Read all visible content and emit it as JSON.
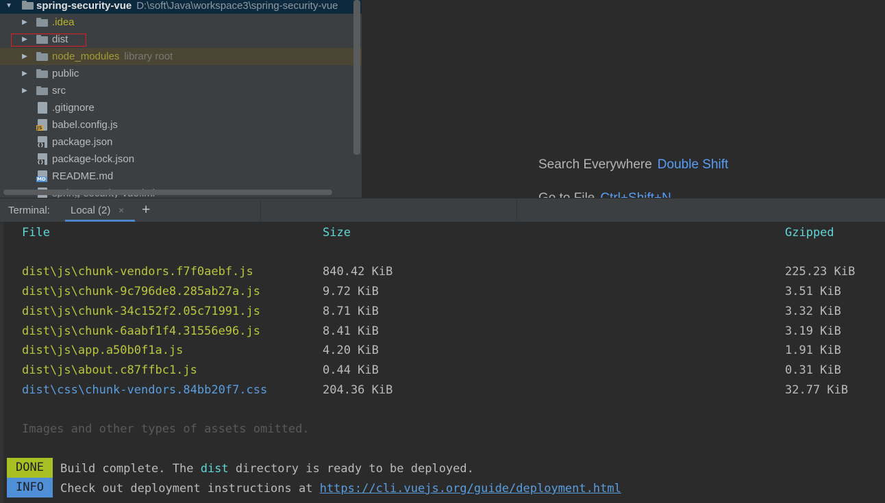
{
  "project": {
    "root_name": "spring-security-vue",
    "root_path": "D:\\soft\\Java\\workspace3\\spring-security-vue",
    "items": [
      {
        "label": ".idea",
        "type": "folder",
        "extra": ""
      },
      {
        "label": "dist",
        "type": "folder",
        "extra": ""
      },
      {
        "label": "node_modules",
        "type": "folder",
        "extra": "library root"
      },
      {
        "label": "public",
        "type": "folder",
        "extra": ""
      },
      {
        "label": "src",
        "type": "folder",
        "extra": ""
      },
      {
        "label": ".gitignore",
        "type": "file",
        "extra": ""
      },
      {
        "label": "babel.config.js",
        "type": "file",
        "extra": "",
        "tag": "JS"
      },
      {
        "label": "package.json",
        "type": "file",
        "extra": "",
        "tag": "{}"
      },
      {
        "label": "package-lock.json",
        "type": "file",
        "extra": "",
        "tag": "{}"
      },
      {
        "label": "README.md",
        "type": "file",
        "extra": "",
        "tag": "MD"
      },
      {
        "label": "spring-security-vue.iml",
        "type": "file",
        "extra": ""
      }
    ]
  },
  "editor": {
    "hints": [
      {
        "action": "Search Everywhere",
        "shortcut": "Double Shift"
      },
      {
        "action": "Go to File",
        "shortcut": "Ctrl+Shift+N"
      }
    ]
  },
  "terminal": {
    "title": "Terminal:",
    "tab_label": "Local (2)",
    "close_glyph": "×",
    "add_glyph": "+",
    "headers": {
      "file": "File",
      "size": "Size",
      "gzipped": "Gzipped"
    },
    "rows": [
      {
        "file": "dist\\js\\chunk-vendors.f7f0aebf.js",
        "size": "840.42 KiB",
        "gzipped": "225.23 KiB"
      },
      {
        "file": "dist\\js\\chunk-9c796de8.285ab27a.js",
        "size": "9.72 KiB",
        "gzipped": "3.51 KiB"
      },
      {
        "file": "dist\\js\\chunk-34c152f2.05c71991.js",
        "size": "8.71 KiB",
        "gzipped": "3.32 KiB"
      },
      {
        "file": "dist\\js\\chunk-6aabf1f4.31556e96.js",
        "size": "8.41 KiB",
        "gzipped": "3.19 KiB"
      },
      {
        "file": "dist\\js\\app.a50b0f1a.js",
        "size": "4.20 KiB",
        "gzipped": "1.91 KiB"
      },
      {
        "file": "dist\\js\\about.c87ffbc1.js",
        "size": "0.44 KiB",
        "gzipped": "0.31 KiB"
      },
      {
        "file": "dist\\css\\chunk-vendors.84bb20f7.css",
        "size": "204.36 KiB",
        "gzipped": "32.77 KiB"
      }
    ],
    "omitted_note": "Images and other types of assets omitted.",
    "done_badge": "DONE",
    "done_msg_pre": "Build complete. The ",
    "done_msg_dir": "dist",
    "done_msg_post": " directory is ready to be deployed.",
    "info_badge": "INFO",
    "info_msg": "Check out deployment instructions at ",
    "info_link": "https://cli.vuejs.org/guide/deployment.html"
  },
  "colors": {
    "accent_blue": "#4a88c7",
    "done_green": "#a8c023",
    "info_blue": "#4e8fd8",
    "js_file_yellow": "#b8c83c",
    "css_file_blue": "#5a9ee0",
    "header_cyan": "#5fd7d7"
  }
}
